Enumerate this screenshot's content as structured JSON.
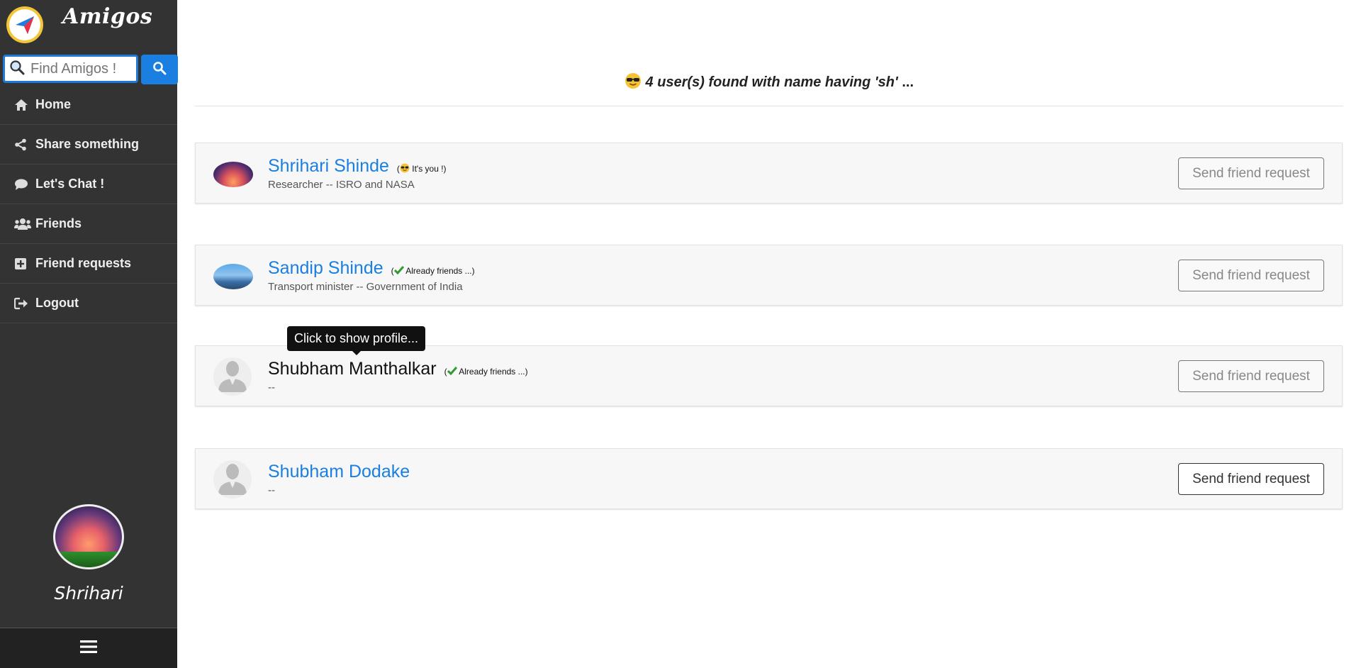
{
  "app": {
    "name": "Amigos"
  },
  "search": {
    "placeholder": "Find Amigos !"
  },
  "nav": [
    {
      "label": "Home",
      "icon": "home-icon"
    },
    {
      "label": "Share something",
      "icon": "share-icon"
    },
    {
      "label": "Let's Chat !",
      "icon": "chat-icon"
    },
    {
      "label": "Friends",
      "icon": "users-icon"
    },
    {
      "label": "Friend requests",
      "icon": "plus-square-icon"
    },
    {
      "label": "Logout",
      "icon": "logout-icon"
    }
  ],
  "profile": {
    "name": "Shrihari"
  },
  "results": {
    "prefix": "4 user(s) found with name having",
    "query": "'sh'",
    "suffix": "..."
  },
  "users": [
    {
      "name": "Shrihari Shinde",
      "tag": "It's you !)",
      "subtitle": "Researcher -- ISRO and NASA",
      "button": "Send friend request"
    },
    {
      "name": "Sandip Shinde",
      "tag": "Already friends ...)",
      "subtitle": "Transport minister -- Government of India",
      "button": "Send friend request"
    },
    {
      "name": "Shubham Manthalkar",
      "tag": "Already friends ...)",
      "subtitle": "--",
      "button": "Send friend request"
    },
    {
      "name": "Shubham Dodake",
      "tag": "",
      "subtitle": "--",
      "button": "Send friend request"
    }
  ],
  "tooltip": "Click to show profile...",
  "colors": {
    "sidebar": "#333333",
    "accent": "#1a7fe0",
    "link": "#1a7fe0"
  }
}
